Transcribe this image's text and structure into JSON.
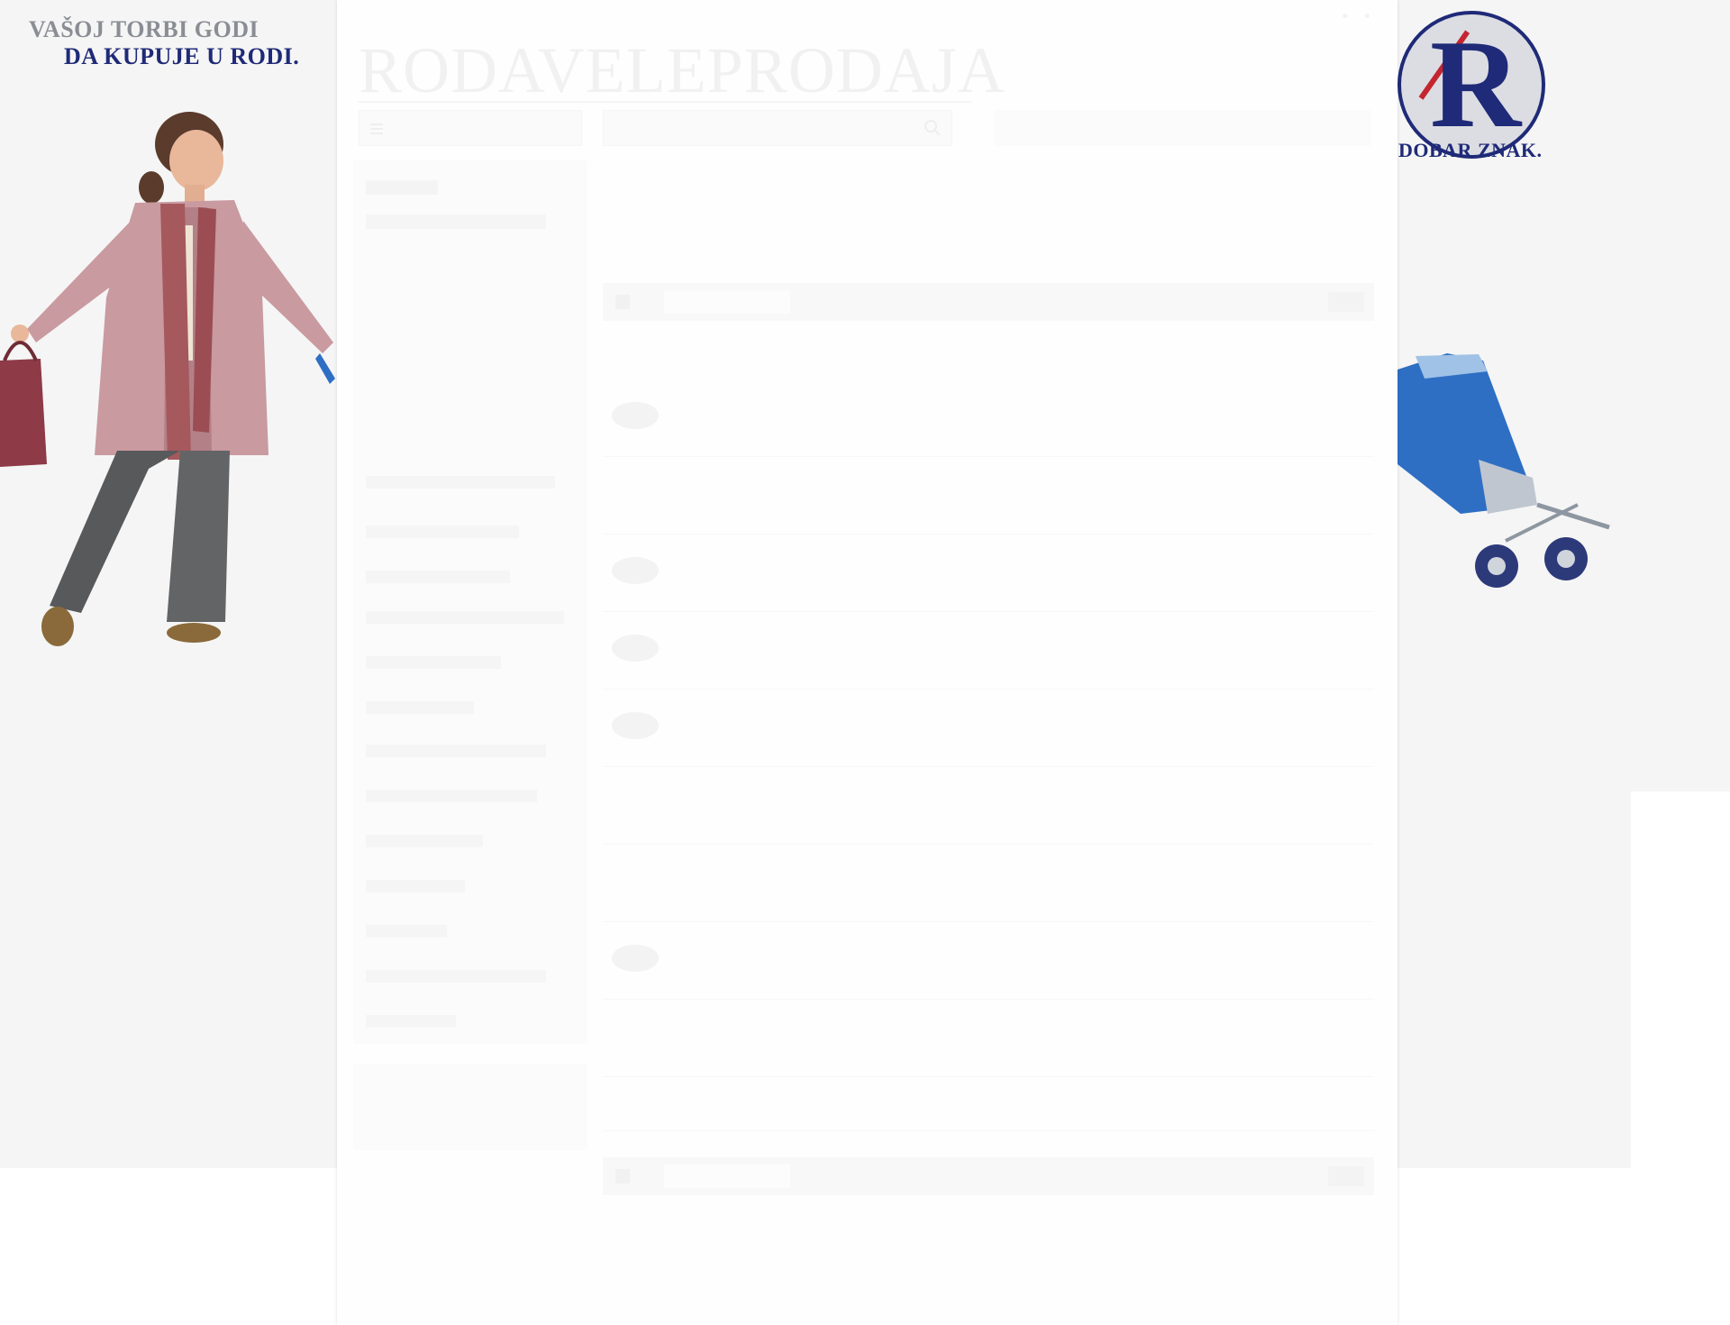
{
  "ad_left": {
    "slogan_line1": "VAŠOJ TORBI GODI",
    "slogan_line2": "DA KUPUJE U RODI.",
    "colors": {
      "gray_text": "#8a8d94",
      "navy_text": "#1f2a78",
      "coat": "#c99aa0",
      "trousers": "#58595b",
      "bag": "#8e3a47"
    }
  },
  "ad_right": {
    "logo_tagline": "DOBAR ZNAK.",
    "colors": {
      "navy": "#1f2a78",
      "red": "#c3262f",
      "trolley_blue": "#2e6fc4"
    }
  },
  "header": {
    "site_title": "RODAVELEPRODAJA"
  },
  "colors": {
    "page_background": "#f5f5f5",
    "content_background": "#fefefe"
  }
}
